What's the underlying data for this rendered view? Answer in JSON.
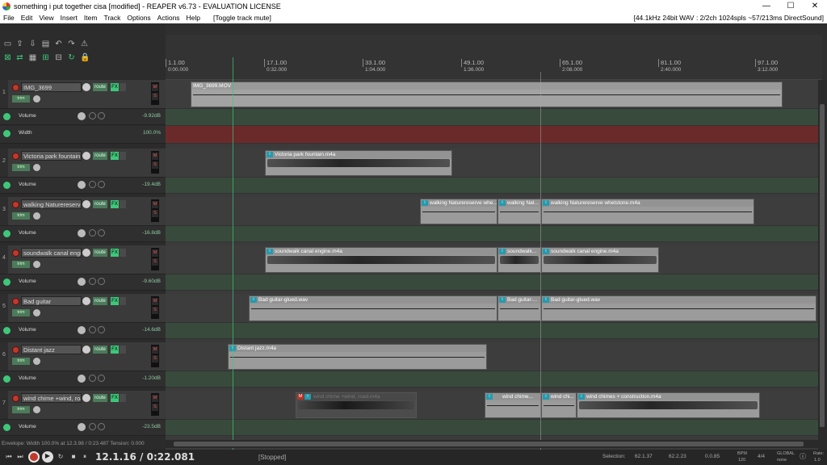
{
  "window": {
    "title": "something i put together cisa [modified] - REAPER v6.73 - EVALUATION LICENSE",
    "minimize": "—",
    "maximize": "☐",
    "close": "✕"
  },
  "menu": {
    "items": [
      "File",
      "Edit",
      "View",
      "Insert",
      "Item",
      "Track",
      "Options",
      "Actions",
      "Help"
    ],
    "last_action": "[Toggle track mute]",
    "audio_status": "[44.1kHz 24bit WAV : 2/2ch 1024spls ~57/213ms DirectSound]"
  },
  "ruler": {
    "marks": [
      {
        "bar": "1.1.00",
        "time": "0:00.000"
      },
      {
        "bar": "17.1.00",
        "time": "0:32.000"
      },
      {
        "bar": "33.1.00",
        "time": "1:04.000"
      },
      {
        "bar": "49.1.00",
        "time": "1:36.000"
      },
      {
        "bar": "65.1.00",
        "time": "2:08.000"
      },
      {
        "bar": "81.1.00",
        "time": "2:40.000"
      },
      {
        "bar": "97.1.00",
        "time": "3:12.000"
      }
    ]
  },
  "tracks": [
    {
      "num": "1",
      "name": "IMG_3699",
      "route": "route",
      "fx": "FX",
      "trim": "trim",
      "env": [
        {
          "label": "Volume",
          "value": "-9.92dB"
        },
        {
          "label": "Width",
          "value": "100.0%"
        }
      ]
    },
    {
      "num": "2",
      "name": "Victoria park fountain",
      "route": "route",
      "fx": "FX",
      "trim": "trim",
      "env": [
        {
          "label": "Volume",
          "value": "-19.4dB"
        }
      ]
    },
    {
      "num": "3",
      "name": "walking Naturereserve w",
      "route": "route",
      "fx": "FX",
      "trim": "trim",
      "env": [
        {
          "label": "Volume",
          "value": "-16.8dB"
        }
      ]
    },
    {
      "num": "4",
      "name": "soundwalk canal engine",
      "route": "route",
      "fx": "FX",
      "trim": "trim",
      "env": [
        {
          "label": "Volume",
          "value": "-9.60dB"
        }
      ]
    },
    {
      "num": "5",
      "name": "Bad guitar",
      "route": "route",
      "fx": "FX",
      "trim": "trim",
      "env": [
        {
          "label": "Volume",
          "value": "-14.6dB"
        }
      ]
    },
    {
      "num": "6",
      "name": "Distant jazz",
      "route": "route",
      "fx": "FX",
      "trim": "trim",
      "env": [
        {
          "label": "Volume",
          "value": "-1.20dB"
        }
      ]
    },
    {
      "num": "7",
      "name": "wind chime +wind, road",
      "route": "route",
      "fx": "FX",
      "trim": "trim",
      "env": [
        {
          "label": "Volume",
          "value": "-23.5dB"
        }
      ]
    }
  ],
  "items": {
    "t1": [
      "IMG_3699.MOV"
    ],
    "t2": [
      "Victoria park fountain.m4a"
    ],
    "t3": [
      "walking Naturereserve whe...",
      "walking Nat...",
      "walking Naturereserve whetstone.m4a"
    ],
    "t4": [
      "soundwalk canal engine.m4a",
      "soundwalk...",
      "soundwalk canal engine.m4a"
    ],
    "t5": [
      "Bad guitar-glued.wav",
      "Bad guitar-...",
      "Bad guitar-glued.wav"
    ],
    "t6": [
      "Distant jazz.m4a"
    ],
    "t7": [
      "wind chime +wind, road.m4a",
      "wind chime...",
      "wind chi...",
      "wind chimes + construction.m4a"
    ]
  },
  "item_badge": "i",
  "mute_badge": "M",
  "env_info": "Envelope: Width 100.0% at 12.3.98 / 0:23.487 Tension: 0.000",
  "transport": {
    "position": "12.1.16 / 0:22.081",
    "state": "[Stopped]",
    "selection_label": "Selection:",
    "sel_start": "62.1.37",
    "sel_end": "62.2.23",
    "sel_len": "0.0.85",
    "bpm_label": "BPM",
    "bpm": "120",
    "timesig": "4/4",
    "rate_label": "Rate:",
    "rate": "1.0",
    "global_label": "GLOBAL",
    "global_mode": "none"
  }
}
